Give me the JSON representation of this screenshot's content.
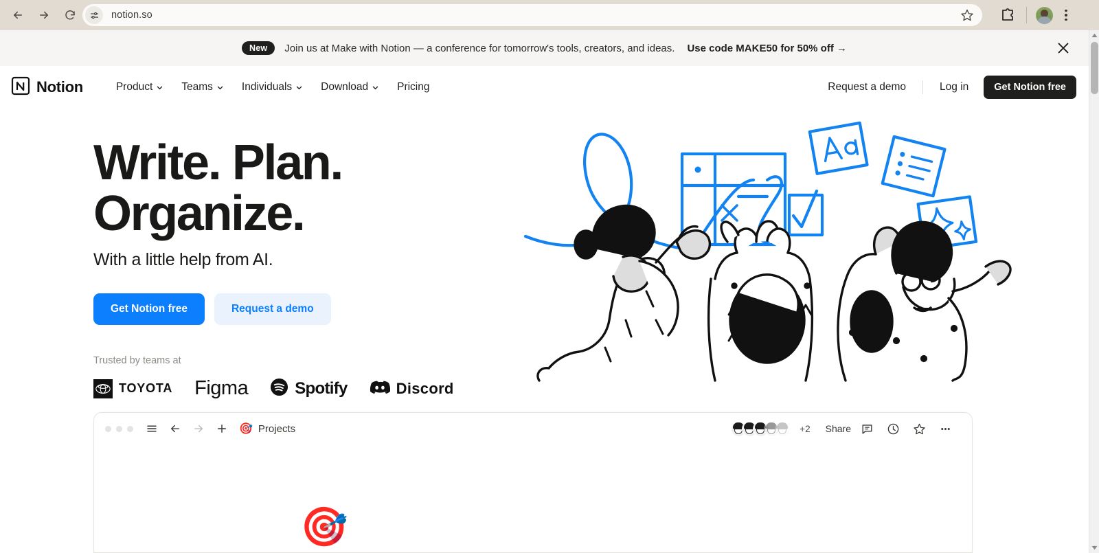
{
  "browser": {
    "back_label": "Back",
    "forward_label": "Forward",
    "reload_label": "Reload",
    "site_settings_label": "View site information",
    "url": "notion.so",
    "bookmark_label": "Bookmark this tab",
    "extensions_label": "Extensions",
    "profile_label": "Profile",
    "menu_label": "Customize and control Chrome"
  },
  "banner": {
    "badge": "New",
    "message": "Join us at Make with Notion — a conference for tomorrow's tools, creators, and ideas.",
    "cta": "Use code MAKE50 for 50% off →",
    "close_label": "Close"
  },
  "header": {
    "brand": "Notion",
    "nav": [
      {
        "label": "Product",
        "has_chevron": true
      },
      {
        "label": "Teams",
        "has_chevron": true
      },
      {
        "label": "Individuals",
        "has_chevron": true
      },
      {
        "label": "Download",
        "has_chevron": true
      },
      {
        "label": "Pricing",
        "has_chevron": false
      }
    ],
    "request_demo": "Request a demo",
    "log_in": "Log in",
    "get_free": "Get Notion free"
  },
  "hero": {
    "title_line1": "Write. Plan.",
    "title_line2": "Organize.",
    "subtitle": "With a little help from AI.",
    "cta_primary": "Get Notion free",
    "cta_secondary": "Request a demo",
    "trusted_label": "Trusted by teams at",
    "logos": [
      {
        "name": "Toyota",
        "text": "TOYOTA"
      },
      {
        "name": "Figma",
        "text": "Figma"
      },
      {
        "name": "Spotify",
        "text": "Spotify"
      },
      {
        "name": "Discord",
        "text": "Discord"
      }
    ],
    "illustration_alt": "Three people celebrating with floating blue doodles of a grid, checkmark, text card, list card and sparkles"
  },
  "mockup": {
    "page_icon": "🎯",
    "page_title": "Projects",
    "avatar_overflow": "+2",
    "share_label": "Share",
    "doc_icon": "🎯"
  },
  "colors": {
    "accent_blue": "#0b7ffd",
    "accent_blue_soft": "#e9f2fd",
    "ink": "#1f1f1e",
    "chrome_bg": "#e2dbd1",
    "banner_bg": "#f6f5f3",
    "doodle_blue": "#1283f0",
    "target_red": "#d04a41"
  }
}
